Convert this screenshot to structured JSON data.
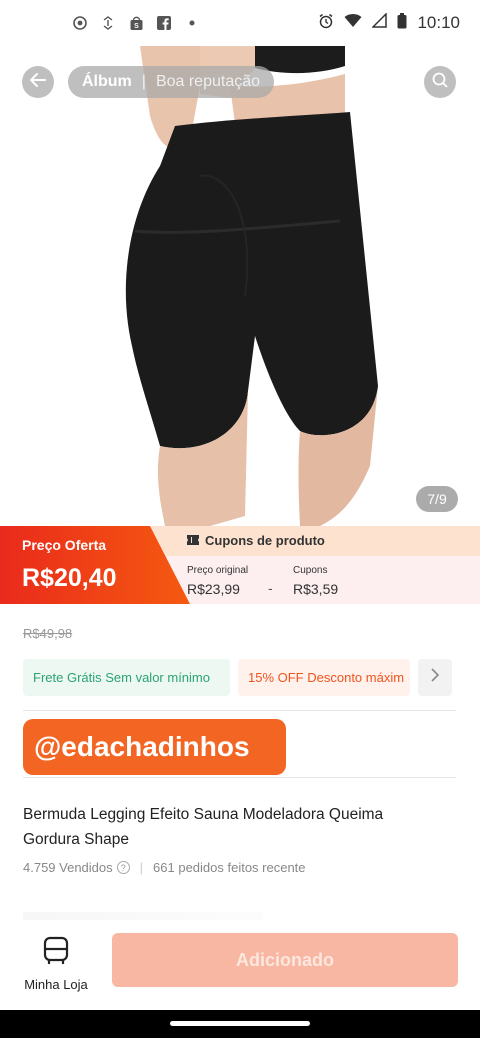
{
  "status_bar": {
    "time": "10:10",
    "icons": [
      "camera-icon",
      "link-icon",
      "shop-icon",
      "facebook-icon",
      "dot-icon",
      "alarm-icon",
      "wifi-icon",
      "signal-icon",
      "battery-icon"
    ]
  },
  "header": {
    "tab_album": "Álbum",
    "tab_reputation": "Boa reputação",
    "icons": [
      "back-arrow-icon",
      "search-icon"
    ]
  },
  "gallery": {
    "counter": "7/9"
  },
  "price": {
    "offer_label": "Preço Oferta",
    "offer_value": "R$20,40",
    "coupon_title": "Cupons de produto",
    "original_label": "Preço original",
    "original_value": "R$23,99",
    "minus": "-",
    "coupons_label": "Cupons",
    "coupons_value": "R$3,59",
    "old_price": "R$49,98"
  },
  "tags": {
    "shipping": "Frete Grátis Sem valor mínimo",
    "discount": "15% OFF Desconto máxim",
    "more": "›"
  },
  "handle": "@edachadinhos",
  "product": {
    "title": "Bermuda Legging Efeito Sauna Modeladora Queima Gordura Shape",
    "sold": "4.759 Vendidos",
    "recent": "661 pedidos feitos recente"
  },
  "bottom": {
    "store_label": "Minha Loja",
    "add_button": "Adicionado"
  },
  "colors": {
    "accent": "#f26522",
    "offer_gradient_start": "#ea2a1c",
    "offer_gradient_end": "#f55a10",
    "green": "#2aa373",
    "button_disabled": "#f8b7a3"
  }
}
